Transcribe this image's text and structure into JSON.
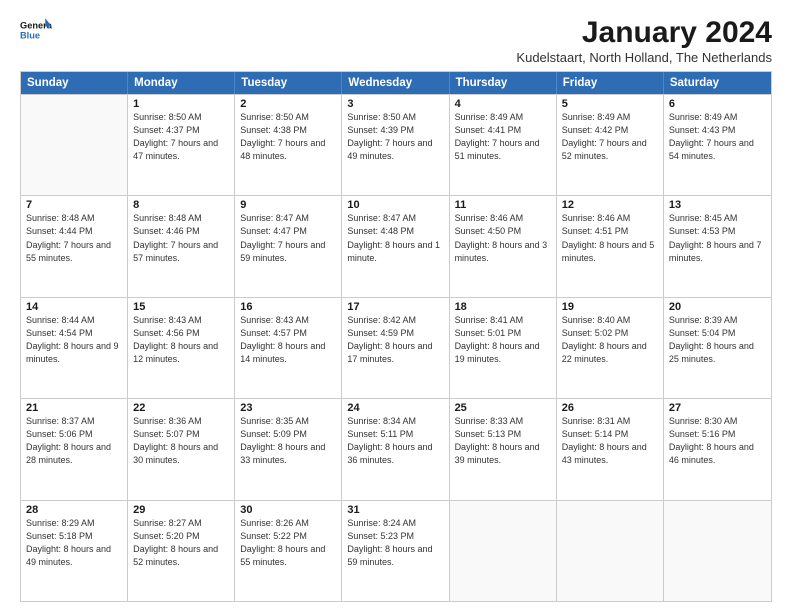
{
  "logo": {
    "line1": "General",
    "line2": "Blue"
  },
  "title": "January 2024",
  "location": "Kudelstaart, North Holland, The Netherlands",
  "headers": [
    "Sunday",
    "Monday",
    "Tuesday",
    "Wednesday",
    "Thursday",
    "Friday",
    "Saturday"
  ],
  "weeks": [
    [
      {
        "day": "",
        "sunrise": "",
        "sunset": "",
        "daylight": ""
      },
      {
        "day": "1",
        "sunrise": "Sunrise: 8:50 AM",
        "sunset": "Sunset: 4:37 PM",
        "daylight": "Daylight: 7 hours and 47 minutes."
      },
      {
        "day": "2",
        "sunrise": "Sunrise: 8:50 AM",
        "sunset": "Sunset: 4:38 PM",
        "daylight": "Daylight: 7 hours and 48 minutes."
      },
      {
        "day": "3",
        "sunrise": "Sunrise: 8:50 AM",
        "sunset": "Sunset: 4:39 PM",
        "daylight": "Daylight: 7 hours and 49 minutes."
      },
      {
        "day": "4",
        "sunrise": "Sunrise: 8:49 AM",
        "sunset": "Sunset: 4:41 PM",
        "daylight": "Daylight: 7 hours and 51 minutes."
      },
      {
        "day": "5",
        "sunrise": "Sunrise: 8:49 AM",
        "sunset": "Sunset: 4:42 PM",
        "daylight": "Daylight: 7 hours and 52 minutes."
      },
      {
        "day": "6",
        "sunrise": "Sunrise: 8:49 AM",
        "sunset": "Sunset: 4:43 PM",
        "daylight": "Daylight: 7 hours and 54 minutes."
      }
    ],
    [
      {
        "day": "7",
        "sunrise": "Sunrise: 8:48 AM",
        "sunset": "Sunset: 4:44 PM",
        "daylight": "Daylight: 7 hours and 55 minutes."
      },
      {
        "day": "8",
        "sunrise": "Sunrise: 8:48 AM",
        "sunset": "Sunset: 4:46 PM",
        "daylight": "Daylight: 7 hours and 57 minutes."
      },
      {
        "day": "9",
        "sunrise": "Sunrise: 8:47 AM",
        "sunset": "Sunset: 4:47 PM",
        "daylight": "Daylight: 7 hours and 59 minutes."
      },
      {
        "day": "10",
        "sunrise": "Sunrise: 8:47 AM",
        "sunset": "Sunset: 4:48 PM",
        "daylight": "Daylight: 8 hours and 1 minute."
      },
      {
        "day": "11",
        "sunrise": "Sunrise: 8:46 AM",
        "sunset": "Sunset: 4:50 PM",
        "daylight": "Daylight: 8 hours and 3 minutes."
      },
      {
        "day": "12",
        "sunrise": "Sunrise: 8:46 AM",
        "sunset": "Sunset: 4:51 PM",
        "daylight": "Daylight: 8 hours and 5 minutes."
      },
      {
        "day": "13",
        "sunrise": "Sunrise: 8:45 AM",
        "sunset": "Sunset: 4:53 PM",
        "daylight": "Daylight: 8 hours and 7 minutes."
      }
    ],
    [
      {
        "day": "14",
        "sunrise": "Sunrise: 8:44 AM",
        "sunset": "Sunset: 4:54 PM",
        "daylight": "Daylight: 8 hours and 9 minutes."
      },
      {
        "day": "15",
        "sunrise": "Sunrise: 8:43 AM",
        "sunset": "Sunset: 4:56 PM",
        "daylight": "Daylight: 8 hours and 12 minutes."
      },
      {
        "day": "16",
        "sunrise": "Sunrise: 8:43 AM",
        "sunset": "Sunset: 4:57 PM",
        "daylight": "Daylight: 8 hours and 14 minutes."
      },
      {
        "day": "17",
        "sunrise": "Sunrise: 8:42 AM",
        "sunset": "Sunset: 4:59 PM",
        "daylight": "Daylight: 8 hours and 17 minutes."
      },
      {
        "day": "18",
        "sunrise": "Sunrise: 8:41 AM",
        "sunset": "Sunset: 5:01 PM",
        "daylight": "Daylight: 8 hours and 19 minutes."
      },
      {
        "day": "19",
        "sunrise": "Sunrise: 8:40 AM",
        "sunset": "Sunset: 5:02 PM",
        "daylight": "Daylight: 8 hours and 22 minutes."
      },
      {
        "day": "20",
        "sunrise": "Sunrise: 8:39 AM",
        "sunset": "Sunset: 5:04 PM",
        "daylight": "Daylight: 8 hours and 25 minutes."
      }
    ],
    [
      {
        "day": "21",
        "sunrise": "Sunrise: 8:37 AM",
        "sunset": "Sunset: 5:06 PM",
        "daylight": "Daylight: 8 hours and 28 minutes."
      },
      {
        "day": "22",
        "sunrise": "Sunrise: 8:36 AM",
        "sunset": "Sunset: 5:07 PM",
        "daylight": "Daylight: 8 hours and 30 minutes."
      },
      {
        "day": "23",
        "sunrise": "Sunrise: 8:35 AM",
        "sunset": "Sunset: 5:09 PM",
        "daylight": "Daylight: 8 hours and 33 minutes."
      },
      {
        "day": "24",
        "sunrise": "Sunrise: 8:34 AM",
        "sunset": "Sunset: 5:11 PM",
        "daylight": "Daylight: 8 hours and 36 minutes."
      },
      {
        "day": "25",
        "sunrise": "Sunrise: 8:33 AM",
        "sunset": "Sunset: 5:13 PM",
        "daylight": "Daylight: 8 hours and 39 minutes."
      },
      {
        "day": "26",
        "sunrise": "Sunrise: 8:31 AM",
        "sunset": "Sunset: 5:14 PM",
        "daylight": "Daylight: 8 hours and 43 minutes."
      },
      {
        "day": "27",
        "sunrise": "Sunrise: 8:30 AM",
        "sunset": "Sunset: 5:16 PM",
        "daylight": "Daylight: 8 hours and 46 minutes."
      }
    ],
    [
      {
        "day": "28",
        "sunrise": "Sunrise: 8:29 AM",
        "sunset": "Sunset: 5:18 PM",
        "daylight": "Daylight: 8 hours and 49 minutes."
      },
      {
        "day": "29",
        "sunrise": "Sunrise: 8:27 AM",
        "sunset": "Sunset: 5:20 PM",
        "daylight": "Daylight: 8 hours and 52 minutes."
      },
      {
        "day": "30",
        "sunrise": "Sunrise: 8:26 AM",
        "sunset": "Sunset: 5:22 PM",
        "daylight": "Daylight: 8 hours and 55 minutes."
      },
      {
        "day": "31",
        "sunrise": "Sunrise: 8:24 AM",
        "sunset": "Sunset: 5:23 PM",
        "daylight": "Daylight: 8 hours and 59 minutes."
      },
      {
        "day": "",
        "sunrise": "",
        "sunset": "",
        "daylight": ""
      },
      {
        "day": "",
        "sunrise": "",
        "sunset": "",
        "daylight": ""
      },
      {
        "day": "",
        "sunrise": "",
        "sunset": "",
        "daylight": ""
      }
    ]
  ]
}
